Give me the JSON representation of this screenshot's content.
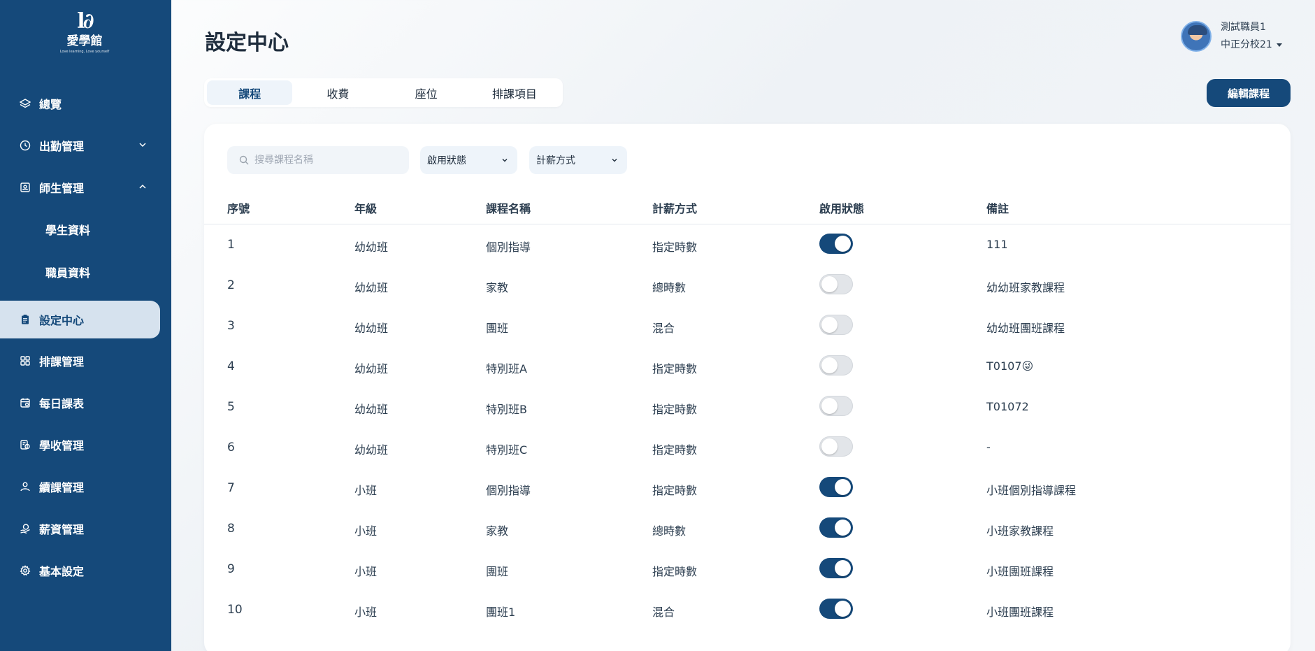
{
  "brand": {
    "logo_mark": "l∂",
    "logo_name": "愛學館",
    "logo_tagline": "Love learning, Love yourself"
  },
  "sidebar": {
    "items": [
      {
        "label": "總覽",
        "icon": "layers-icon"
      },
      {
        "label": "出勤管理",
        "icon": "clock-icon",
        "expand": "chevron-down-icon"
      },
      {
        "label": "師生管理",
        "icon": "id-card-icon",
        "expand": "chevron-up-icon"
      },
      {
        "label": "學生資料",
        "sub": true
      },
      {
        "label": "職員資料",
        "sub": true
      },
      {
        "label": "設定中心",
        "icon": "clipboard-icon",
        "active": true
      },
      {
        "label": "排課管理",
        "icon": "grid-icon"
      },
      {
        "label": "每日課表",
        "icon": "schedule-icon"
      },
      {
        "label": "學收管理",
        "icon": "coins-icon"
      },
      {
        "label": "續課管理",
        "icon": "user-hand-icon"
      },
      {
        "label": "薪資管理",
        "icon": "salary-icon"
      },
      {
        "label": "基本設定",
        "icon": "gear-icon"
      }
    ]
  },
  "header": {
    "title": "設定中心",
    "user_name": "測試職員1",
    "branch": "中正分校21"
  },
  "tabs": [
    "課程",
    "收費",
    "座位",
    "排課項目"
  ],
  "active_tab": "課程",
  "edit_button": "編輯課程",
  "filters": {
    "search_placeholder": "搜尋課程名稱",
    "status_select": "啟用狀態",
    "pay_select": "計薪方式"
  },
  "table": {
    "columns": [
      "序號",
      "年級",
      "課程名稱",
      "計薪方式",
      "啟用狀態",
      "備註"
    ],
    "rows": [
      {
        "no": "1",
        "grade": "幼幼班",
        "name": "個別指導",
        "pay": "指定時數",
        "enabled": true,
        "note": "111"
      },
      {
        "no": "2",
        "grade": "幼幼班",
        "name": "家教",
        "pay": "總時數",
        "enabled": false,
        "note": "幼幼班家教課程"
      },
      {
        "no": "3",
        "grade": "幼幼班",
        "name": "團班",
        "pay": "混合",
        "enabled": false,
        "note": "幼幼班團班課程"
      },
      {
        "no": "4",
        "grade": "幼幼班",
        "name": "特別班A",
        "pay": "指定時數",
        "enabled": false,
        "note": "T0107😜"
      },
      {
        "no": "5",
        "grade": "幼幼班",
        "name": "特別班B",
        "pay": "指定時數",
        "enabled": false,
        "note": "T01072"
      },
      {
        "no": "6",
        "grade": "幼幼班",
        "name": "特別班C",
        "pay": "指定時數",
        "enabled": false,
        "note": "-"
      },
      {
        "no": "7",
        "grade": "小班",
        "name": "個別指導",
        "pay": "指定時數",
        "enabled": true,
        "note": "小班個別指導課程"
      },
      {
        "no": "8",
        "grade": "小班",
        "name": "家教",
        "pay": "總時數",
        "enabled": true,
        "note": "小班家教課程"
      },
      {
        "no": "9",
        "grade": "小班",
        "name": "團班",
        "pay": "指定時數",
        "enabled": true,
        "note": "小班團班課程"
      },
      {
        "no": "10",
        "grade": "小班",
        "name": "團班1",
        "pay": "混合",
        "enabled": true,
        "note": "小班團班課程"
      }
    ]
  },
  "colors": {
    "primary": "#15497a",
    "active_bg": "#d6e2ee",
    "toggle_off": "#e2e5e9"
  }
}
